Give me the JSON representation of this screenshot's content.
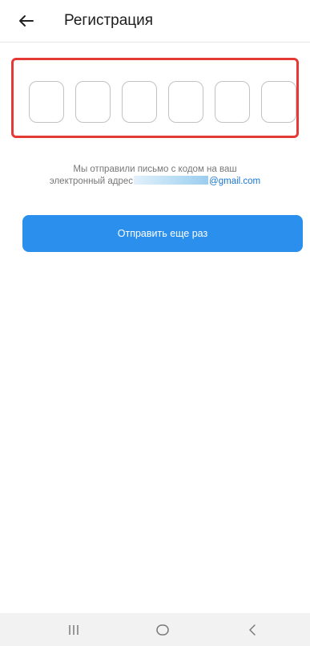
{
  "header": {
    "title": "Регистрация",
    "back_icon": "arrow-left-icon"
  },
  "code_input": {
    "cell_count": 6,
    "highlight_color": "#e53935"
  },
  "info": {
    "line1": "Мы отправили письмо с кодом на ваш",
    "line2_prefix": "электронный адрес",
    "email_domain": "@gmail.com"
  },
  "resend_button": {
    "label": "Отправить еще раз",
    "color": "#2b8fed"
  },
  "navbar": {
    "recent_icon": "recent-apps-icon",
    "home_icon": "home-icon",
    "back_icon": "chevron-left-icon"
  }
}
